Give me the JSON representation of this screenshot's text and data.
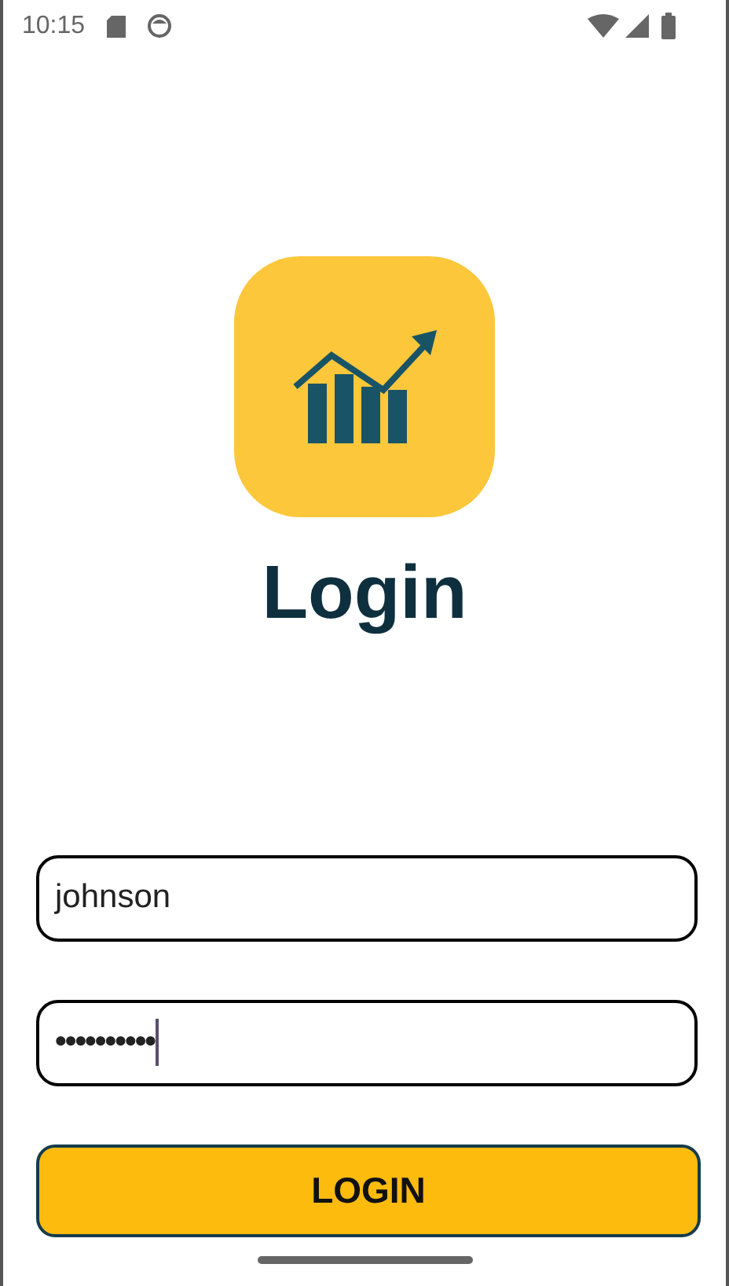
{
  "status_bar": {
    "time": "10:15"
  },
  "title": "Login",
  "fields": [
    {
      "kind": "text",
      "value": "johnson",
      "focused": false
    },
    {
      "kind": "password",
      "value": "••••••••••",
      "focused": true
    }
  ],
  "button": {
    "label": "LOGIN"
  }
}
